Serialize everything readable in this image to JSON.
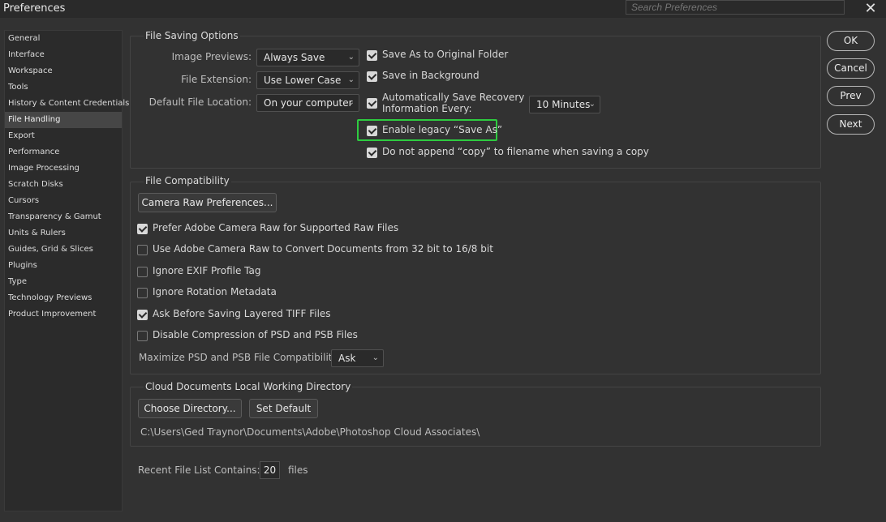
{
  "window": {
    "title": "Preferences",
    "search_placeholder": "Search Preferences",
    "close": "✕"
  },
  "sidebar": {
    "items": [
      {
        "label": "General"
      },
      {
        "label": "Interface"
      },
      {
        "label": "Workspace"
      },
      {
        "label": "Tools"
      },
      {
        "label": "History & Content Credentials"
      },
      {
        "label": "File Handling",
        "active": true
      },
      {
        "label": "Export"
      },
      {
        "label": "Performance"
      },
      {
        "label": "Image Processing"
      },
      {
        "label": "Scratch Disks"
      },
      {
        "label": "Cursors"
      },
      {
        "label": "Transparency & Gamut"
      },
      {
        "label": "Units & Rulers"
      },
      {
        "label": "Guides, Grid & Slices"
      },
      {
        "label": "Plugins"
      },
      {
        "label": "Type"
      },
      {
        "label": "Technology Previews"
      },
      {
        "label": "Product Improvement"
      }
    ]
  },
  "file_saving": {
    "legend": "File Saving Options",
    "image_previews": {
      "label": "Image Previews:",
      "value": "Always Save"
    },
    "file_extension": {
      "label": "File Extension:",
      "value": "Use Lower Case"
    },
    "default_location": {
      "label": "Default File Location:",
      "value": "On your computer"
    },
    "save_as_original": {
      "label": "Save As to Original Folder",
      "checked": true
    },
    "save_background": {
      "label": "Save in Background",
      "checked": true
    },
    "auto_save": {
      "label_line1": "Automatically Save Recovery",
      "label_line2": "Information Every:",
      "checked": true,
      "interval": "10 Minutes"
    },
    "legacy_save_as": {
      "label": "Enable legacy “Save As”",
      "checked": true
    },
    "no_copy": {
      "label": "Do not append “copy” to filename when saving a copy",
      "checked": true
    },
    "highlight_color": "#2ecc40"
  },
  "file_compat": {
    "legend": "File Compatibility",
    "camera_raw_button": "Camera Raw Preferences...",
    "options": [
      {
        "label": "Prefer Adobe Camera Raw for Supported Raw Files",
        "checked": true
      },
      {
        "label": "Use Adobe Camera Raw to Convert Documents from 32 bit to 16/8 bit",
        "checked": false
      },
      {
        "label": "Ignore EXIF Profile Tag",
        "checked": false
      },
      {
        "label": "Ignore Rotation Metadata",
        "checked": false
      },
      {
        "label": "Ask Before Saving Layered TIFF Files",
        "checked": true
      },
      {
        "label": "Disable Compression of PSD and PSB Files",
        "checked": false
      }
    ],
    "maximize": {
      "label": "Maximize PSD and PSB File Compatibility:",
      "value": "Ask"
    }
  },
  "cloud": {
    "legend": "Cloud Documents Local Working Directory",
    "choose_button": "Choose Directory...",
    "default_button": "Set Default",
    "path": "C:\\Users\\Ged Traynor\\Documents\\Adobe\\Photoshop Cloud Associates\\"
  },
  "recent": {
    "label": "Recent File List Contains:",
    "value": "20",
    "suffix": "files"
  },
  "buttons": {
    "ok": "OK",
    "cancel": "Cancel",
    "prev": "Prev",
    "next": "Next"
  }
}
